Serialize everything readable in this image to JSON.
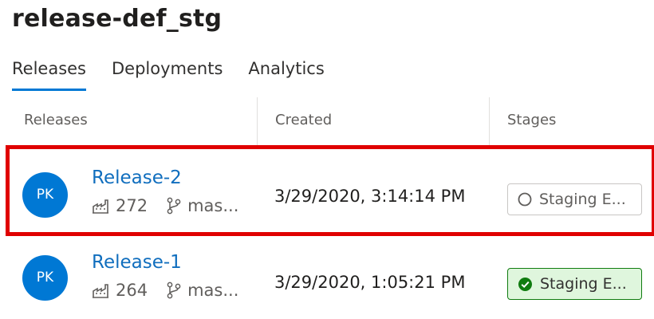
{
  "page_title": "release-def_stg",
  "tabs": [
    {
      "label": "Releases",
      "active": true
    },
    {
      "label": "Deployments",
      "active": false
    },
    {
      "label": "Analytics",
      "active": false
    }
  ],
  "columns": [
    "Releases",
    "Created",
    "Stages"
  ],
  "rows": [
    {
      "avatar": "PK",
      "name": "Release-2",
      "build": "272",
      "branch": "mas...",
      "created": "3/29/2020, 3:14:14 PM",
      "stage": "Staging E...",
      "stage_status": "not-deployed",
      "highlighted": true
    },
    {
      "avatar": "PK",
      "name": "Release-1",
      "build": "264",
      "branch": "mas...",
      "created": "3/29/2020, 1:05:21 PM",
      "stage": "Staging E...",
      "stage_status": "succeeded",
      "highlighted": false
    }
  ],
  "icons": {
    "build": "build-artifact-icon",
    "branch": "branch-icon",
    "not_deployed": "empty-circle-icon",
    "succeeded": "check-circle-icon"
  },
  "colors": {
    "accent": "#0078d4",
    "link": "#106ebe",
    "success_fill": "#dff6dd",
    "success_border": "#107c10",
    "highlight": "#e00000"
  }
}
